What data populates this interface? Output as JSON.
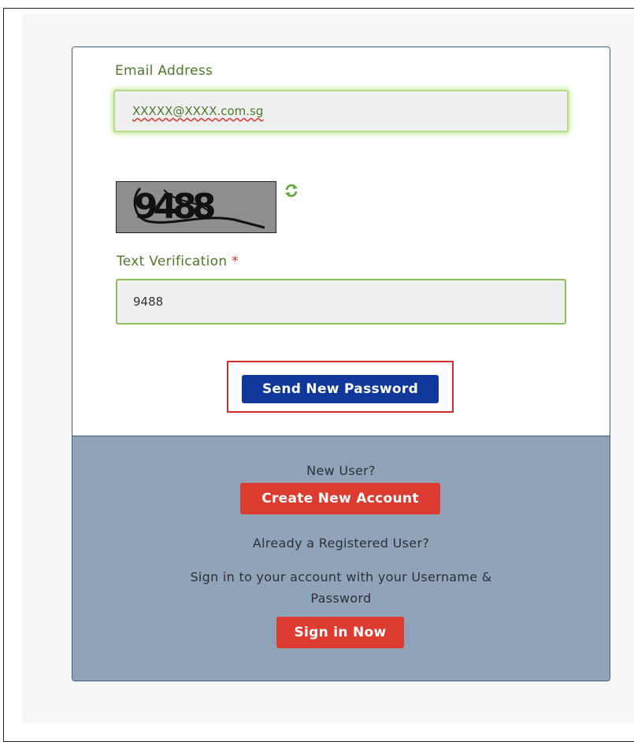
{
  "form": {
    "email_label": "Email Address",
    "email_value": "XXXXX@XXXX.com.sg",
    "captcha_text": "9488",
    "verification_label": "Text Verification",
    "required_marker": "*",
    "verification_value": "9488",
    "send_button_label": "Send New Password"
  },
  "footer": {
    "new_user_text": "New User?",
    "create_account_label": "Create New Account",
    "registered_text": "Already a Registered User?",
    "sign_in_prompt_line1": "Sign in to your account with your Username &",
    "sign_in_prompt_line2": "Password",
    "sign_in_label": "Sign in Now"
  },
  "icons": {
    "refresh": "refresh-icon"
  },
  "colors": {
    "label_green": "#4e7a2c",
    "primary_button": "#10389a",
    "danger_button": "#dc3b2f",
    "footer_bg": "#90a3b8",
    "highlight_border": "#d62b2b"
  }
}
